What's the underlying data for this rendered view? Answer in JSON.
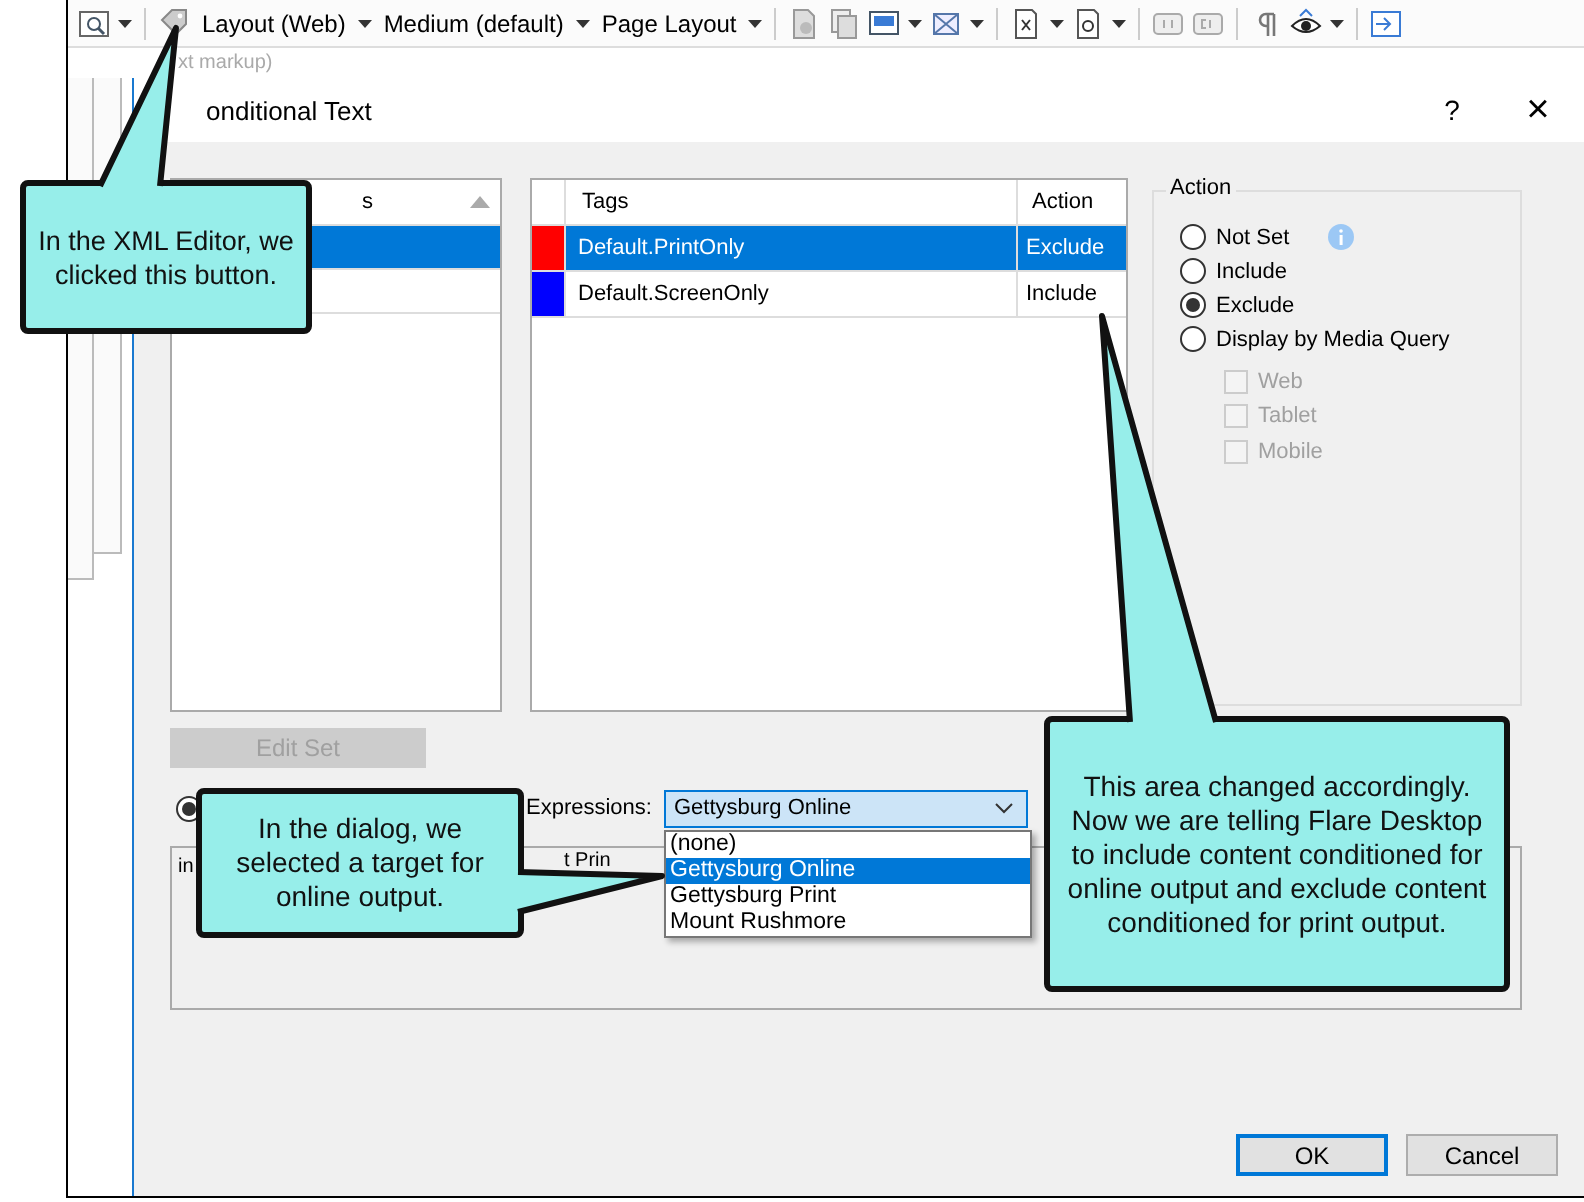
{
  "toolbar": {
    "menus": [
      {
        "label": "Layout (Web)"
      },
      {
        "label": "Medium (default)"
      },
      {
        "label": "Page Layout"
      }
    ]
  },
  "editor": {
    "hint": "xt markup)"
  },
  "dialog": {
    "title": "onditional Text",
    "help": "?",
    "close": "×",
    "condition_sets": {
      "header": "s",
      "rows": [
        {
          "selected": true
        },
        {
          "selected": false
        }
      ]
    },
    "tags": {
      "columns": [
        "Tags",
        "Action"
      ],
      "rows": [
        {
          "color": "#ff0000",
          "tag": "Default.PrintOnly",
          "action": "Exclude",
          "selected": true
        },
        {
          "color": "#0000ff",
          "tag": "Default.ScreenOnly",
          "action": "Include",
          "selected": false
        }
      ]
    },
    "action": {
      "title": "Action",
      "options": [
        {
          "label": "Not Set",
          "selected": false,
          "info": true
        },
        {
          "label": "Include",
          "selected": false,
          "info": false
        },
        {
          "label": "Exclude",
          "selected": true,
          "info": false
        },
        {
          "label": "Display by Media Query",
          "selected": false,
          "info": false
        }
      ],
      "media": [
        {
          "label": "Web",
          "checked": false,
          "disabled": true
        },
        {
          "label": "Tablet",
          "checked": false,
          "disabled": true
        },
        {
          "label": "Mobile",
          "checked": false,
          "disabled": true
        }
      ]
    },
    "edit_set": {
      "label": "Edit Set",
      "disabled": true
    },
    "expression": {
      "radio_selected": true,
      "label": "Expressions:",
      "value": "Gettysburg Online",
      "options": [
        {
          "label": "(none)",
          "selected": false
        },
        {
          "label": "Gettysburg Online",
          "selected": true
        },
        {
          "label": "Gettysburg Print",
          "selected": false
        },
        {
          "label": "Mount Rushmore",
          "selected": false
        }
      ]
    },
    "preview": {
      "texts": [
        "in",
        "t Prin"
      ]
    },
    "buttons": [
      {
        "label": "OK",
        "default": true
      },
      {
        "label": "Cancel",
        "default": false
      }
    ]
  },
  "callouts": [
    {
      "text": "In the XML Editor, we clicked this button."
    },
    {
      "text": "In the dialog, we selected a target for online output."
    },
    {
      "text": "This area changed accordingly. Now we are telling Flare Desktop to include content conditioned for online output and exclude content conditioned for print output."
    }
  ]
}
